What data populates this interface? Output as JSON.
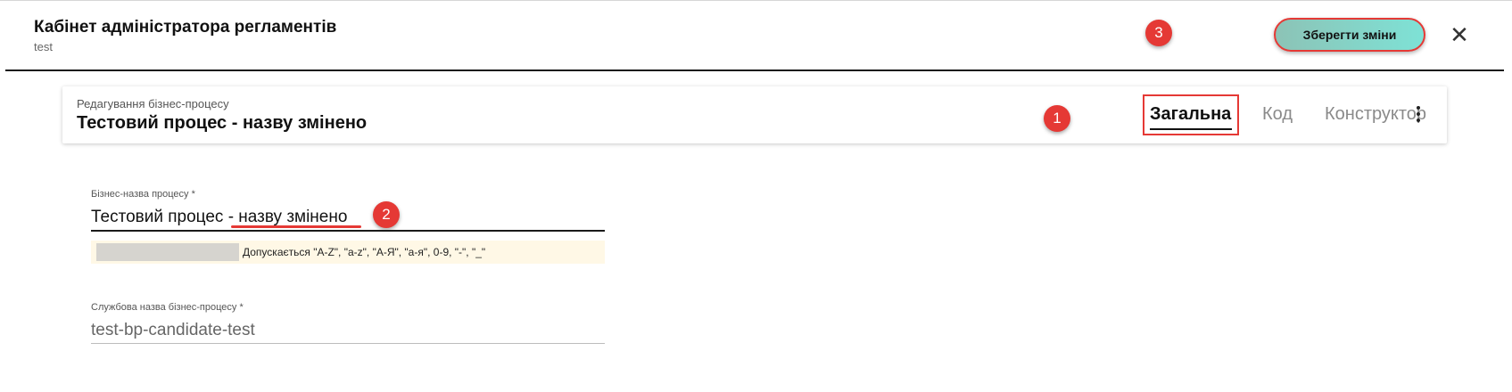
{
  "header": {
    "title": "Кабінет адміністратора регламентів",
    "subtitle": "test",
    "save_label": "Зберегти зміни",
    "close_icon": "close-icon"
  },
  "card": {
    "label": "Редагування бізнес-процесу",
    "title": "Тестовий процес - назву змінено",
    "tabs": [
      {
        "label": "Загальна",
        "active": true
      },
      {
        "label": "Код",
        "active": false
      },
      {
        "label": "Конструктор",
        "active": false
      }
    ],
    "menu_icon": "more-vertical-icon"
  },
  "form": {
    "business_name": {
      "label": "Бізнес-назва процесу *",
      "value": "Тестовий процес - назву змінено",
      "hint": "Допускається \"A-Z\", \"a-z\", \"А-Я\", \"а-я\", 0-9, \"-\", \"_\""
    },
    "service_name": {
      "label": "Службова назва бізнес-процесу *",
      "value": "test-bp-candidate-test"
    }
  },
  "annotations": [
    "1",
    "2",
    "3"
  ],
  "colors": {
    "accent_red": "#e53935",
    "save_gradient_start": "#8cc3b6",
    "save_gradient_end": "#7ee2d6",
    "hint_background": "#fff8e6"
  }
}
